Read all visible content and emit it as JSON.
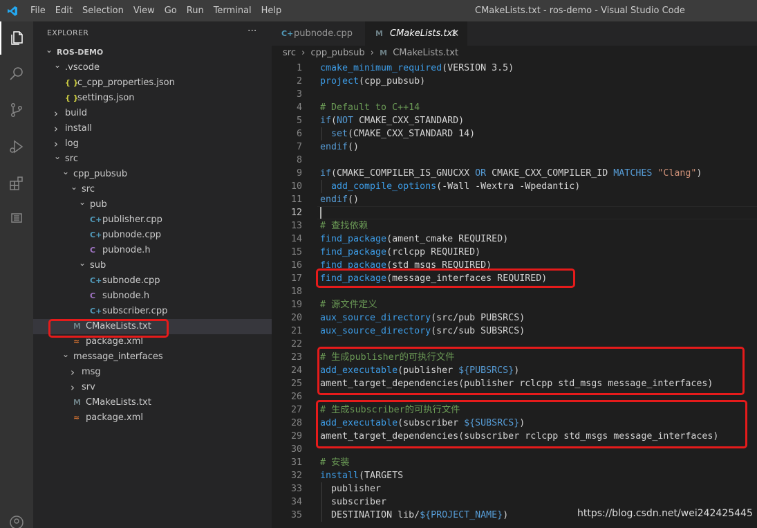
{
  "titlebar": {
    "menu": [
      "File",
      "Edit",
      "Selection",
      "View",
      "Go",
      "Run",
      "Terminal",
      "Help"
    ],
    "window_title": "CMakeLists.txt - ros-demo - Visual Studio Code"
  },
  "activity_bar": {
    "icons": [
      "explorer-icon",
      "search-icon",
      "source-control-icon",
      "run-debug-icon",
      "extensions-icon",
      "outline-icon",
      "account-icon"
    ]
  },
  "sidebar": {
    "title": "EXPLORER",
    "more": "···",
    "items": [
      {
        "label": "ROS-DEMO",
        "kind": "root"
      },
      {
        "label": ".vscode",
        "kind": "folder-open"
      },
      {
        "label": "c_cpp_properties.json",
        "kind": "json"
      },
      {
        "label": "settings.json",
        "kind": "json"
      },
      {
        "label": "build",
        "kind": "folder"
      },
      {
        "label": "install",
        "kind": "folder"
      },
      {
        "label": "log",
        "kind": "folder"
      },
      {
        "label": "src",
        "kind": "folder-open"
      },
      {
        "label": "cpp_pubsub",
        "kind": "folder-open"
      },
      {
        "label": "src",
        "kind": "folder-open"
      },
      {
        "label": "pub",
        "kind": "folder-open"
      },
      {
        "label": "publisher.cpp",
        "kind": "cpp"
      },
      {
        "label": "pubnode.cpp",
        "kind": "cpp"
      },
      {
        "label": "pubnode.h",
        "kind": "h"
      },
      {
        "label": "sub",
        "kind": "folder-open"
      },
      {
        "label": "subnode.cpp",
        "kind": "cpp"
      },
      {
        "label": "subnode.h",
        "kind": "h"
      },
      {
        "label": "subscriber.cpp",
        "kind": "cpp"
      },
      {
        "label": "CMakeLists.txt",
        "kind": "cmake",
        "selected": true
      },
      {
        "label": "package.xml",
        "kind": "xml"
      },
      {
        "label": "message_interfaces",
        "kind": "folder-open"
      },
      {
        "label": "msg",
        "kind": "folder"
      },
      {
        "label": "srv",
        "kind": "folder"
      },
      {
        "label": "CMakeLists.txt",
        "kind": "cmake"
      },
      {
        "label": "package.xml",
        "kind": "xml"
      }
    ]
  },
  "tabs": [
    {
      "label": "pubnode.cpp",
      "icon": "C+",
      "active": false
    },
    {
      "label": "CMakeLists.txt",
      "icon": "M",
      "active": true,
      "close": "✕"
    }
  ],
  "breadcrumb": [
    "src",
    "cpp_pubsub",
    "CMakeLists.txt"
  ],
  "breadcrumb_sep": "›",
  "editor": {
    "current_line": 12,
    "lines": [
      "cmake_minimum_required(VERSION 3.5)",
      "project(cpp_pubsub)",
      "",
      "# Default to C++14",
      "if(NOT CMAKE_CXX_STANDARD)",
      "  set(CMAKE_CXX_STANDARD 14)",
      "endif()",
      "",
      "if(CMAKE_COMPILER_IS_GNUCXX OR CMAKE_CXX_COMPILER_ID MATCHES \"Clang\")",
      "  add_compile_options(-Wall -Wextra -Wpedantic)",
      "endif()",
      "",
      "# 查找依赖",
      "find_package(ament_cmake REQUIRED)",
      "find_package(rclcpp REQUIRED)",
      "find_package(std_msgs REQUIRED)",
      "find_package(message_interfaces REQUIRED)",
      "",
      "# 源文件定义",
      "aux_source_directory(src/pub PUBSRCS)",
      "aux_source_directory(src/sub SUBSRCS)",
      "",
      "# 生成publisher的可执行文件",
      "add_executable(publisher ${PUBSRCS})",
      "ament_target_dependencies(publisher rclcpp std_msgs message_interfaces)",
      "",
      "# 生成subscriber的可执行文件",
      "add_executable(subscriber ${SUBSRCS})",
      "ament_target_dependencies(subscriber rclcpp std_msgs message_interfaces)",
      "",
      "# 安装",
      "install(TARGETS",
      "  publisher",
      "  subscriber",
      "  DESTINATION lib/${PROJECT_NAME})"
    ]
  },
  "watermark": "https://blog.csdn.net/wei242425445",
  "colors": {
    "highlight_box": "#e51b1b",
    "keyword": "#569cd6",
    "comment": "#6a9955",
    "string": "#ce9178"
  }
}
